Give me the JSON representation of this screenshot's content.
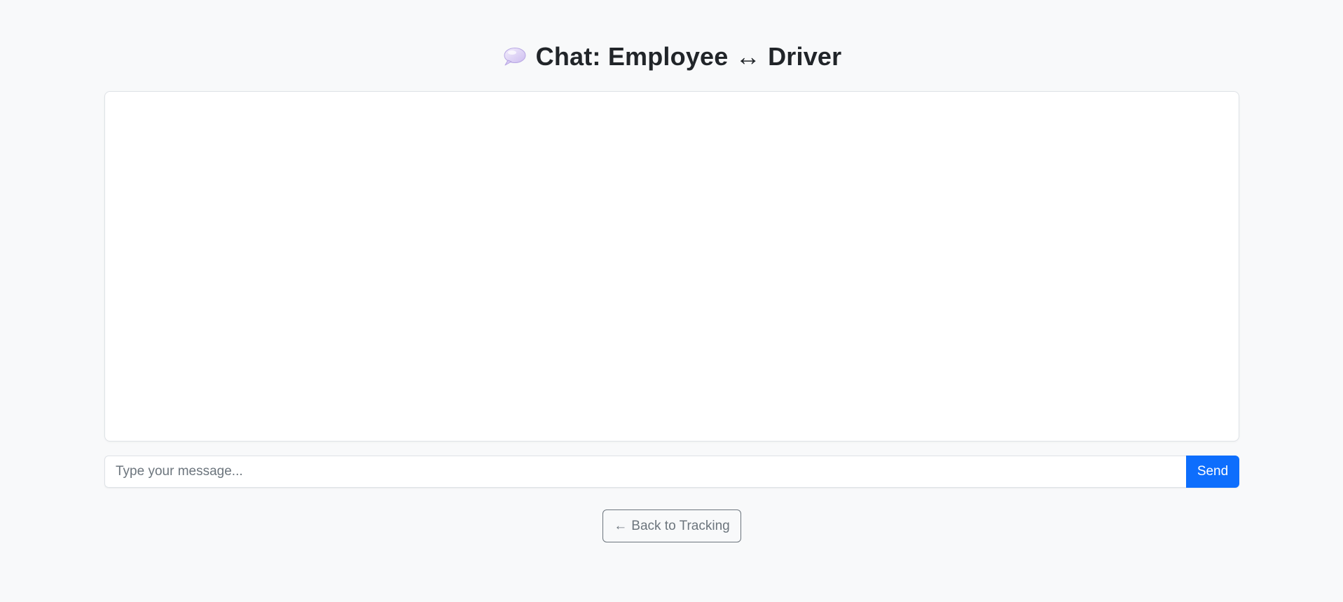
{
  "header": {
    "icon": "speech-balloon-icon",
    "title": "Chat: Employee ↔ Driver"
  },
  "chat": {
    "messages": []
  },
  "composer": {
    "placeholder": "Type your message...",
    "value": "",
    "send_label": "Send"
  },
  "navigation": {
    "back_arrow": "←",
    "back_label": "Back to Tracking"
  },
  "colors": {
    "page_background": "#f8f9fa",
    "primary": "#0d6efd",
    "secondary": "#6c757d",
    "border": "#dee2e6"
  }
}
